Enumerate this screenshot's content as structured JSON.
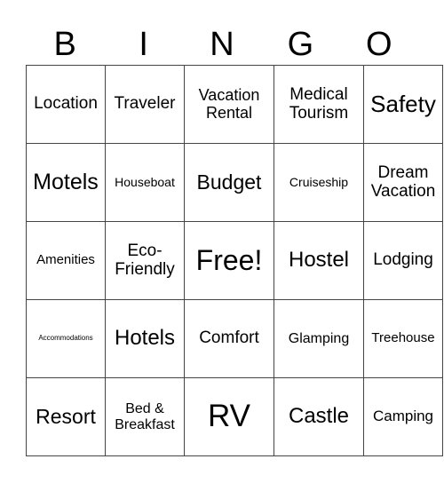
{
  "header": [
    "B",
    "I",
    "N",
    "G",
    "O"
  ],
  "cells": [
    [
      {
        "text": "Location",
        "size": 19
      },
      {
        "text": "Traveler",
        "size": 19
      },
      {
        "text": "Vacation Rental",
        "size": 18
      },
      {
        "text": "Medical Tourism",
        "size": 19
      },
      {
        "text": "Safety",
        "size": 26
      }
    ],
    [
      {
        "text": "Motels",
        "size": 25
      },
      {
        "text": "Houseboat",
        "size": 14
      },
      {
        "text": "Budget",
        "size": 23
      },
      {
        "text": "Cruiseship",
        "size": 14
      },
      {
        "text": "Dream Vacation",
        "size": 19
      }
    ],
    [
      {
        "text": "Amenities",
        "size": 15
      },
      {
        "text": "Eco-Friendly",
        "size": 19
      },
      {
        "text": "Free!",
        "size": 32
      },
      {
        "text": "Hostel",
        "size": 24
      },
      {
        "text": "Lodging",
        "size": 19
      }
    ],
    [
      {
        "text": "Accommodations",
        "size": 8
      },
      {
        "text": "Hotels",
        "size": 24
      },
      {
        "text": "Comfort",
        "size": 19
      },
      {
        "text": "Glamping",
        "size": 16
      },
      {
        "text": "Treehouse",
        "size": 15
      }
    ],
    [
      {
        "text": "Resort",
        "size": 23
      },
      {
        "text": "Bed & Breakfast",
        "size": 16
      },
      {
        "text": "RV",
        "size": 35
      },
      {
        "text": "Castle",
        "size": 24
      },
      {
        "text": "Camping",
        "size": 17
      }
    ]
  ]
}
